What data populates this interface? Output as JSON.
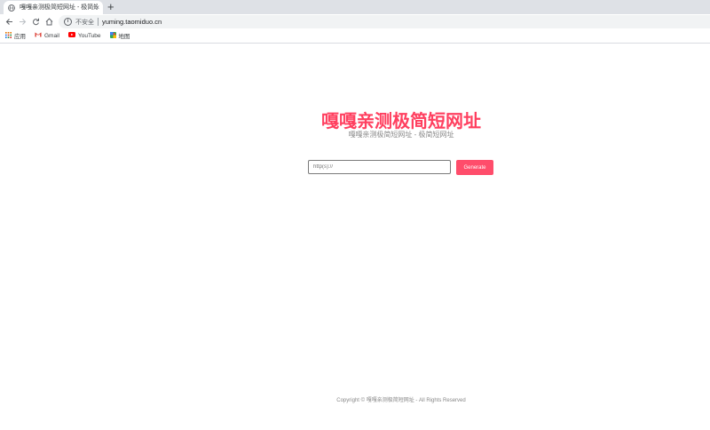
{
  "browser": {
    "tab_title": "嘎嘎亲测极简短网址 - 极简短网址",
    "tab_close": "×",
    "new_tab": "+",
    "security_label": "不安全",
    "url": "yuming.taomiduo.cn"
  },
  "bookmarks": [
    {
      "label": "应用",
      "icon": "apps-grid-icon"
    },
    {
      "label": "Gmail",
      "icon": "gmail-icon"
    },
    {
      "label": "YouTube",
      "icon": "youtube-icon"
    },
    {
      "label": "地图",
      "icon": "maps-icon"
    }
  ],
  "page": {
    "title": "嘎嘎亲测极简短网址",
    "subtitle": "嘎嘎亲测极简短网址 - 极简短网址",
    "input_placeholder": "http(s)://",
    "generate_label": "Generate",
    "footer": "Copyright © 嘎嘎亲测极简短网址 - All Rights Reserved"
  },
  "colors": {
    "accent": "#ff3f5f",
    "button": "#ff4d6b"
  }
}
